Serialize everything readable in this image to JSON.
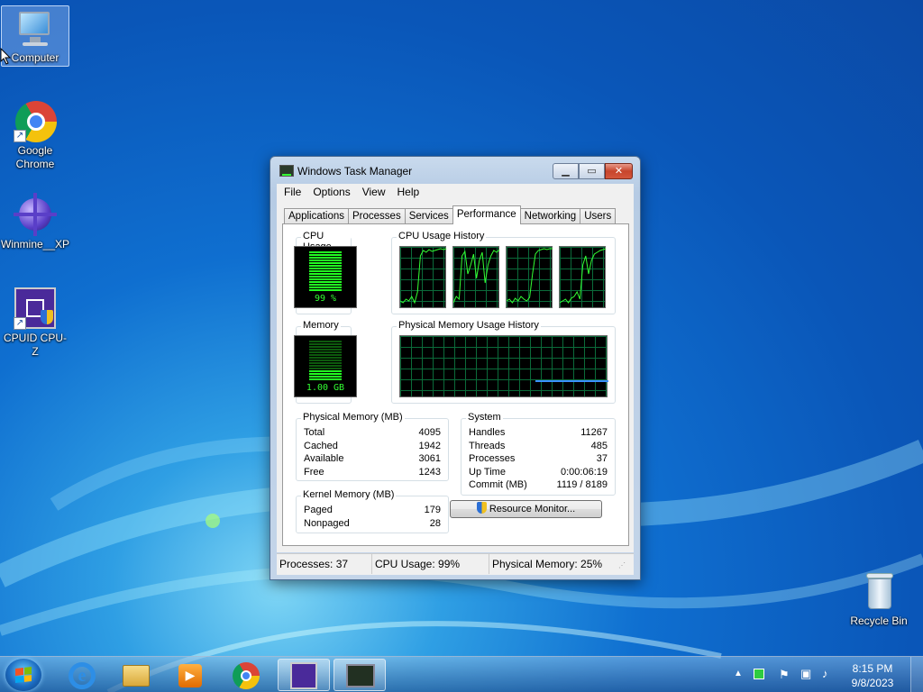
{
  "desktop": {
    "icons": [
      {
        "label": "Computer",
        "icon": "computer-icon"
      },
      {
        "label": "Google Chrome",
        "icon": "chrome-icon"
      },
      {
        "label": "Winmine__XP",
        "icon": "minesweeper-icon"
      },
      {
        "label": "CPUID CPU-Z",
        "icon": "cpuz-icon"
      },
      {
        "label": "Recycle Bin",
        "icon": "recycle-bin-icon"
      }
    ]
  },
  "window": {
    "title": "Windows Task Manager",
    "menu": [
      "File",
      "Options",
      "View",
      "Help"
    ],
    "tabs": [
      "Applications",
      "Processes",
      "Services",
      "Performance",
      "Networking",
      "Users"
    ],
    "active_tab": "Performance",
    "cpu_usage": {
      "label": "CPU Usage",
      "value_text": "99 %",
      "value": 99
    },
    "cpu_history": {
      "label": "CPU Usage History"
    },
    "memory": {
      "label": "Memory",
      "value_text": "1.00 GB"
    },
    "mem_history": {
      "label": "Physical Memory Usage History"
    },
    "physical_memory": {
      "label": "Physical Memory (MB)",
      "rows": [
        {
          "k": "Total",
          "v": "4095"
        },
        {
          "k": "Cached",
          "v": "1942"
        },
        {
          "k": "Available",
          "v": "3061"
        },
        {
          "k": "Free",
          "v": "1243"
        }
      ]
    },
    "kernel_memory": {
      "label": "Kernel Memory (MB)",
      "rows": [
        {
          "k": "Paged",
          "v": "179"
        },
        {
          "k": "Nonpaged",
          "v": "28"
        }
      ]
    },
    "system": {
      "label": "System",
      "rows": [
        {
          "k": "Handles",
          "v": "11267"
        },
        {
          "k": "Threads",
          "v": "485"
        },
        {
          "k": "Processes",
          "v": "37"
        },
        {
          "k": "Up Time",
          "v": "0:00:06:19"
        },
        {
          "k": "Commit (MB)",
          "v": "1119 / 8189"
        }
      ]
    },
    "resource_monitor_button": "Resource Monitor...",
    "status": {
      "processes": "Processes: 37",
      "cpu": "CPU Usage: 99%",
      "memory": "Physical Memory: 25%"
    }
  },
  "taskbar": {
    "pinned": [
      "internet-explorer-icon",
      "windows-explorer-icon",
      "media-player-icon",
      "chrome-icon",
      "cpuz-icon",
      "task-manager-icon"
    ],
    "active_item": "task-manager-icon",
    "clock_time": "8:15 PM",
    "clock_date": "9/8/2023"
  },
  "colors": {
    "graph_green": "#33ff33",
    "graph_grid": "#0b6b3a",
    "memory_line": "#3b8fff"
  }
}
